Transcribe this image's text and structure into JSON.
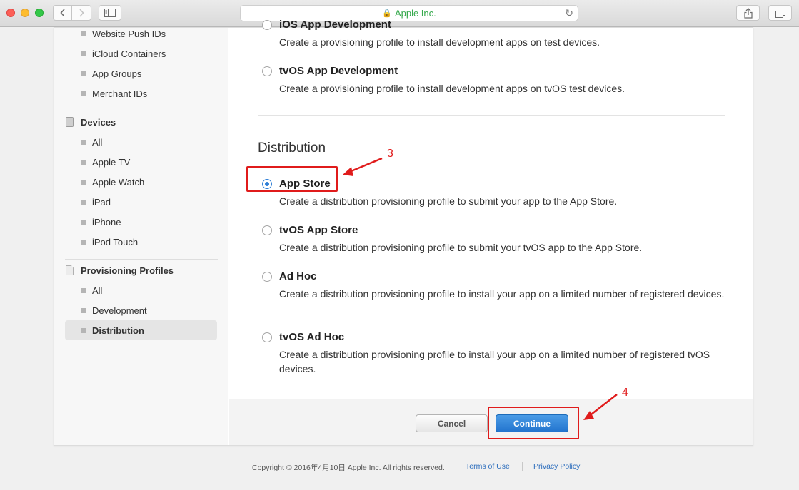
{
  "browser": {
    "address": "Apple Inc.",
    "colors": {
      "lock": "#35a94c"
    }
  },
  "sidebar": {
    "top_items": [
      "Website Push IDs",
      "iCloud Containers",
      "App Groups",
      "Merchant IDs"
    ],
    "devices": {
      "header": "Devices",
      "items": [
        "All",
        "Apple TV",
        "Apple Watch",
        "iPad",
        "iPhone",
        "iPod Touch"
      ]
    },
    "profiles": {
      "header": "Provisioning Profiles",
      "items": [
        "All",
        "Development",
        "Distribution"
      ],
      "selected": "Distribution"
    }
  },
  "main": {
    "partial_option": {
      "title": "iOS App Development",
      "desc": "Create a provisioning profile to install development apps on test devices."
    },
    "development_options": [
      {
        "title": "tvOS App Development",
        "desc": "Create a provisioning profile to install development apps on tvOS test devices.",
        "checked": false
      }
    ],
    "distribution_title": "Distribution",
    "distribution_options": [
      {
        "title": "App Store",
        "desc": "Create a distribution provisioning profile to submit your app to the App Store.",
        "checked": true
      },
      {
        "title": "tvOS App Store",
        "desc": "Create a distribution provisioning profile to submit your tvOS app to the App Store.",
        "checked": false
      },
      {
        "title": "Ad Hoc",
        "desc": "Create a distribution provisioning profile to install your app on a limited number of registered devices.",
        "checked": false
      },
      {
        "title": "tvOS Ad Hoc",
        "desc": "Create a distribution provisioning profile to install your app on a limited number of registered tvOS devices.",
        "checked": false
      }
    ],
    "cancel_label": "Cancel",
    "continue_label": "Continue"
  },
  "footer": {
    "copyright": "Copyright © 2016年4月10日 Apple Inc. All rights reserved.",
    "terms": "Terms of Use",
    "privacy": "Privacy Policy"
  },
  "annotations": {
    "step_a": "3",
    "step_b": "4",
    "color": "#e01b1b"
  }
}
